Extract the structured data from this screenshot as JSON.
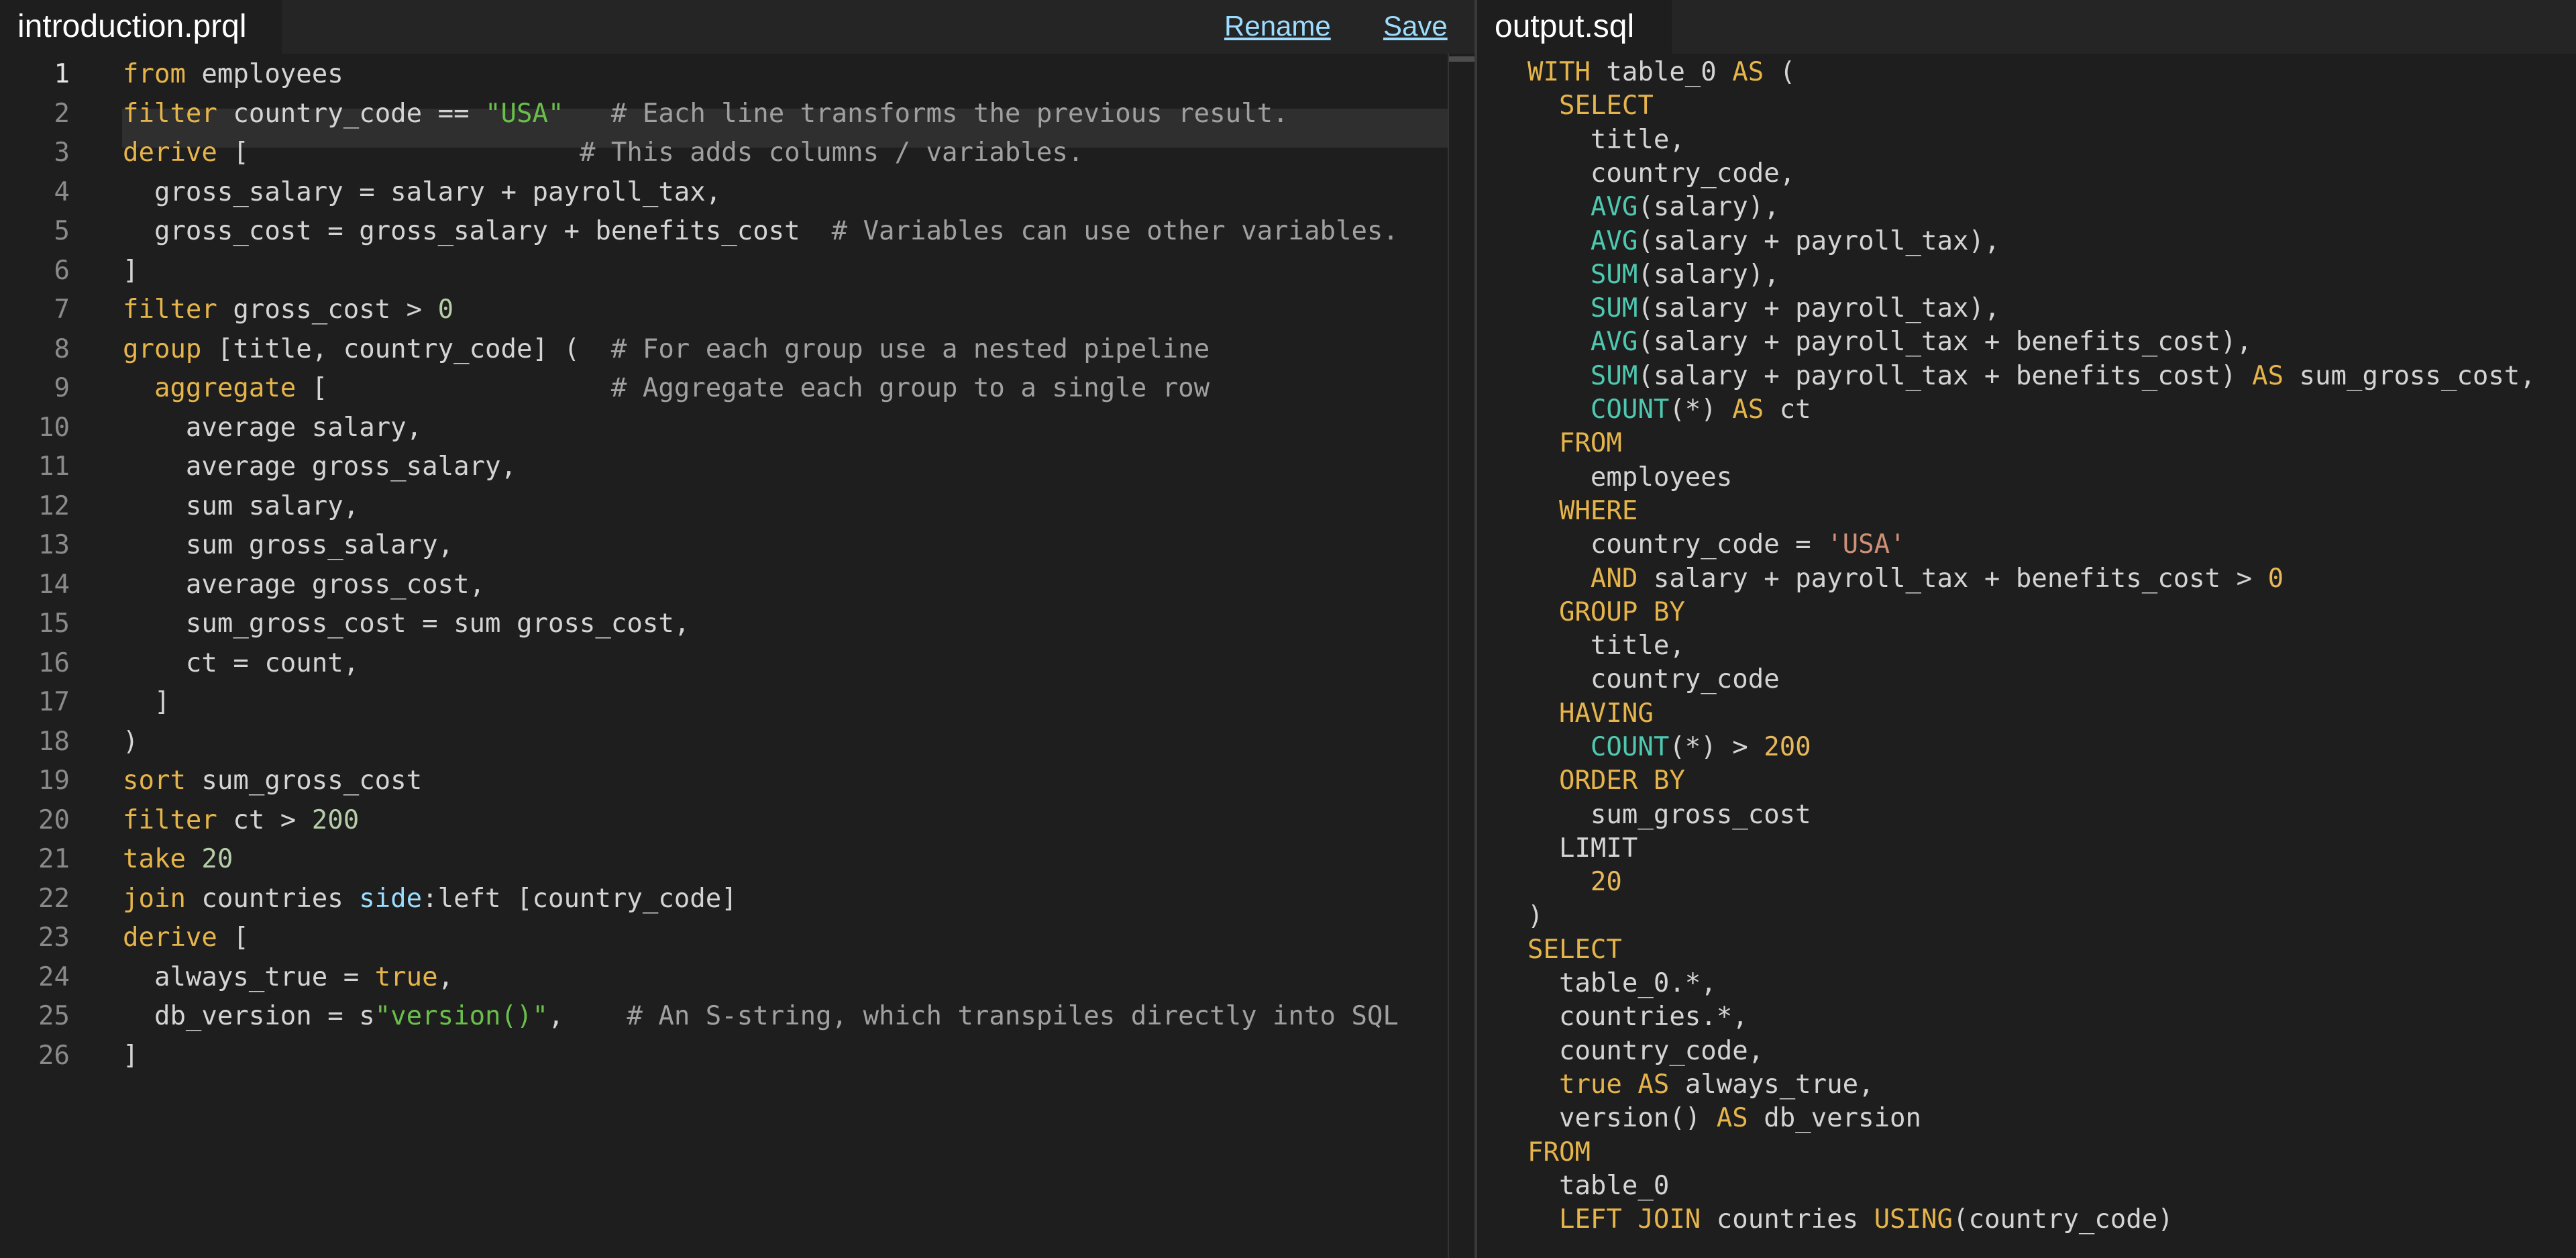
{
  "editor": {
    "tab_title": "introduction.prql",
    "rename_label": "Rename",
    "save_label": "Save",
    "lines": [
      {
        "n": "1",
        "seg": [
          [
            "kw",
            "from"
          ],
          [
            "p",
            " employees"
          ]
        ]
      },
      {
        "n": "2",
        "seg": [
          [
            "kw",
            "filter"
          ],
          [
            "p",
            " country_code == "
          ],
          [
            "str",
            "\"USA\""
          ],
          [
            "p",
            "   "
          ],
          [
            "com",
            "# Each line transforms the previous result."
          ]
        ]
      },
      {
        "n": "3",
        "seg": [
          [
            "kw",
            "derive"
          ],
          [
            "p",
            " [                     "
          ],
          [
            "com",
            "# This adds columns / variables."
          ]
        ]
      },
      {
        "n": "4",
        "seg": [
          [
            "p",
            "  gross_salary = salary + payroll_tax,"
          ]
        ]
      },
      {
        "n": "5",
        "seg": [
          [
            "p",
            "  gross_cost = gross_salary + benefits_cost  "
          ],
          [
            "com",
            "# Variables can use other variables."
          ]
        ]
      },
      {
        "n": "6",
        "seg": [
          [
            "p",
            "]"
          ]
        ]
      },
      {
        "n": "7",
        "seg": [
          [
            "kw",
            "filter"
          ],
          [
            "p",
            " gross_cost > "
          ],
          [
            "num",
            "0"
          ]
        ]
      },
      {
        "n": "8",
        "seg": [
          [
            "kw",
            "group"
          ],
          [
            "p",
            " [title, country_code] (  "
          ],
          [
            "com",
            "# For each group use a nested pipeline"
          ]
        ]
      },
      {
        "n": "9",
        "seg": [
          [
            "p",
            "  "
          ],
          [
            "kw",
            "aggregate"
          ],
          [
            "p",
            " [                  "
          ],
          [
            "com",
            "# Aggregate each group to a single row"
          ]
        ]
      },
      {
        "n": "10",
        "seg": [
          [
            "p",
            "    average salary,"
          ]
        ]
      },
      {
        "n": "11",
        "seg": [
          [
            "p",
            "    average gross_salary,"
          ]
        ]
      },
      {
        "n": "12",
        "seg": [
          [
            "p",
            "    sum salary,"
          ]
        ]
      },
      {
        "n": "13",
        "seg": [
          [
            "p",
            "    sum gross_salary,"
          ]
        ]
      },
      {
        "n": "14",
        "seg": [
          [
            "p",
            "    average gross_cost,"
          ]
        ]
      },
      {
        "n": "15",
        "seg": [
          [
            "p",
            "    sum_gross_cost = sum gross_cost,"
          ]
        ]
      },
      {
        "n": "16",
        "seg": [
          [
            "p",
            "    ct = count,"
          ]
        ]
      },
      {
        "n": "17",
        "seg": [
          [
            "p",
            "  ]"
          ]
        ]
      },
      {
        "n": "18",
        "seg": [
          [
            "p",
            ")"
          ]
        ]
      },
      {
        "n": "19",
        "seg": [
          [
            "kw",
            "sort"
          ],
          [
            "p",
            " sum_gross_cost"
          ]
        ]
      },
      {
        "n": "20",
        "seg": [
          [
            "kw",
            "filter"
          ],
          [
            "p",
            " ct > "
          ],
          [
            "num",
            "200"
          ]
        ]
      },
      {
        "n": "21",
        "seg": [
          [
            "kw",
            "take"
          ],
          [
            "p",
            " "
          ],
          [
            "num",
            "20"
          ]
        ]
      },
      {
        "n": "22",
        "seg": [
          [
            "kw",
            "join"
          ],
          [
            "p",
            " countries "
          ],
          [
            "prop",
            "side"
          ],
          [
            "p",
            ":left [country_code]"
          ]
        ]
      },
      {
        "n": "23",
        "seg": [
          [
            "kw",
            "derive"
          ],
          [
            "p",
            " ["
          ]
        ]
      },
      {
        "n": "24",
        "seg": [
          [
            "p",
            "  always_true = "
          ],
          [
            "kw",
            "true"
          ],
          [
            "p",
            ","
          ]
        ]
      },
      {
        "n": "25",
        "seg": [
          [
            "p",
            "  db_version = s"
          ],
          [
            "str",
            "\"version()\""
          ],
          [
            "p",
            ",    "
          ],
          [
            "com",
            "# An S-string, which transpiles directly into SQL"
          ]
        ]
      },
      {
        "n": "26",
        "seg": [
          [
            "p",
            "]"
          ]
        ]
      }
    ]
  },
  "output": {
    "tab_title": "output.sql",
    "lines": [
      [
        [
          "kw",
          "WITH"
        ],
        [
          "p",
          " table_0 "
        ],
        [
          "kw",
          "AS"
        ],
        [
          "p",
          " ("
        ]
      ],
      [
        [
          "p",
          "  "
        ],
        [
          "kw",
          "SELECT"
        ]
      ],
      [
        [
          "p",
          "    title,"
        ]
      ],
      [
        [
          "p",
          "    country_code,"
        ]
      ],
      [
        [
          "p",
          "    "
        ],
        [
          "fn",
          "AVG"
        ],
        [
          "p",
          "(salary),"
        ]
      ],
      [
        [
          "p",
          "    "
        ],
        [
          "fn",
          "AVG"
        ],
        [
          "p",
          "(salary + payroll_tax),"
        ]
      ],
      [
        [
          "p",
          "    "
        ],
        [
          "fn",
          "SUM"
        ],
        [
          "p",
          "(salary),"
        ]
      ],
      [
        [
          "p",
          "    "
        ],
        [
          "fn",
          "SUM"
        ],
        [
          "p",
          "(salary + payroll_tax),"
        ]
      ],
      [
        [
          "p",
          "    "
        ],
        [
          "fn",
          "AVG"
        ],
        [
          "p",
          "(salary + payroll_tax + benefits_cost),"
        ]
      ],
      [
        [
          "p",
          "    "
        ],
        [
          "fn",
          "SUM"
        ],
        [
          "p",
          "(salary + payroll_tax + benefits_cost) "
        ],
        [
          "kw",
          "AS"
        ],
        [
          "p",
          " sum_gross_cost,"
        ]
      ],
      [
        [
          "p",
          "    "
        ],
        [
          "fn",
          "COUNT"
        ],
        [
          "p",
          "(*) "
        ],
        [
          "kw",
          "AS"
        ],
        [
          "p",
          " ct"
        ]
      ],
      [
        [
          "p",
          "  "
        ],
        [
          "kw",
          "FROM"
        ]
      ],
      [
        [
          "p",
          "    employees"
        ]
      ],
      [
        [
          "p",
          "  "
        ],
        [
          "kw",
          "WHERE"
        ]
      ],
      [
        [
          "p",
          "    country_code = "
        ],
        [
          "stro",
          "'USA'"
        ]
      ],
      [
        [
          "p",
          "    "
        ],
        [
          "kw",
          "AND"
        ],
        [
          "p",
          " salary + payroll_tax + benefits_cost > "
        ],
        [
          "numo",
          "0"
        ]
      ],
      [
        [
          "p",
          "  "
        ],
        [
          "kw",
          "GROUP BY"
        ]
      ],
      [
        [
          "p",
          "    title,"
        ]
      ],
      [
        [
          "p",
          "    country_code"
        ]
      ],
      [
        [
          "p",
          "  "
        ],
        [
          "kw",
          "HAVING"
        ]
      ],
      [
        [
          "p",
          "    "
        ],
        [
          "fn",
          "COUNT"
        ],
        [
          "p",
          "(*) > "
        ],
        [
          "numo",
          "200"
        ]
      ],
      [
        [
          "p",
          "  "
        ],
        [
          "kw",
          "ORDER BY"
        ]
      ],
      [
        [
          "p",
          "    sum_gross_cost"
        ]
      ],
      [
        [
          "p",
          "  LIMIT"
        ]
      ],
      [
        [
          "p",
          "    "
        ],
        [
          "numo",
          "20"
        ]
      ],
      [
        [
          "p",
          ")"
        ]
      ],
      [
        [
          "kw",
          "SELECT"
        ]
      ],
      [
        [
          "p",
          "  table_0.*,"
        ]
      ],
      [
        [
          "p",
          "  countries.*,"
        ]
      ],
      [
        [
          "p",
          "  country_code,"
        ]
      ],
      [
        [
          "p",
          "  "
        ],
        [
          "kw",
          "true"
        ],
        [
          "p",
          " "
        ],
        [
          "kw",
          "AS"
        ],
        [
          "p",
          " always_true,"
        ]
      ],
      [
        [
          "p",
          "  version() "
        ],
        [
          "kw",
          "AS"
        ],
        [
          "p",
          " db_version"
        ]
      ],
      [
        [
          "kw",
          "FROM"
        ]
      ],
      [
        [
          "p",
          "  table_0"
        ]
      ],
      [
        [
          "p",
          "  "
        ],
        [
          "kw",
          "LEFT JOIN"
        ],
        [
          "p",
          " countries "
        ],
        [
          "kw",
          "USING"
        ],
        [
          "p",
          "(country_code)"
        ]
      ]
    ]
  }
}
